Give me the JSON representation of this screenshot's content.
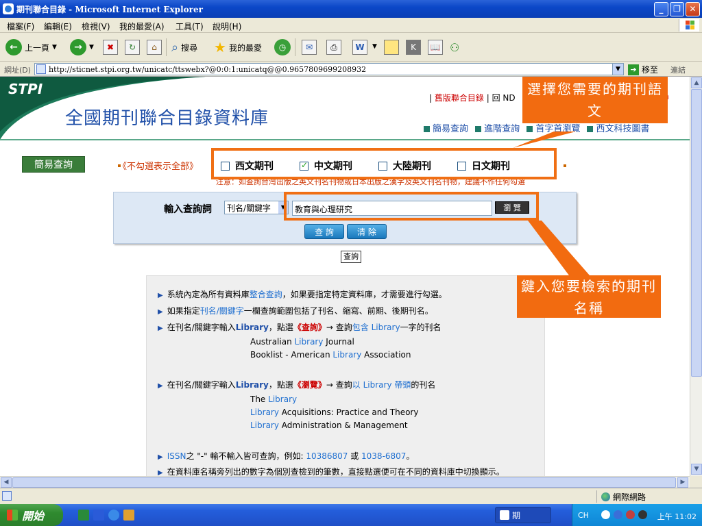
{
  "window": {
    "title": "期刊聯合目錄 - Microsoft Internet Explorer",
    "min": "_",
    "max": "❐",
    "close": "✕"
  },
  "menu": [
    "檔案(F)",
    "編輯(E)",
    "檢視(V)",
    "我的最愛(A)",
    "工具(T)",
    "說明(H)"
  ],
  "toolbar": {
    "back_label": "上一頁",
    "search_label": "搜尋",
    "favorites_label": "我的最愛"
  },
  "address": {
    "label": "網址(D)",
    "url": "http://sticnet.stpi.org.tw/unicatc/ttswebx?@0:0:1:unicatq@@0.9657809699208932",
    "go_label": "移至",
    "links_label": "連結"
  },
  "header": {
    "logo": "STPI",
    "title": "全國期刊聯合目錄資料庫",
    "top_link": "舊版聯合目錄",
    "top_link_2": "回 ND",
    "top_link_3": "sh",
    "nav": [
      "簡易查詢",
      "進階查詢",
      "首字首瀏覽",
      "西文科技圖書"
    ]
  },
  "tabs": {
    "simple": "簡易查詢"
  },
  "languages": {
    "prefix": "《不勾選表示全部》",
    "items": [
      {
        "label": "西文期刊",
        "checked": false
      },
      {
        "label": "中文期刊",
        "checked": true
      },
      {
        "label": "大陸期刊",
        "checked": false
      },
      {
        "label": "日文期刊",
        "checked": false
      }
    ],
    "note": "注意：如查詢台灣出版之英文刊名刊物或日本出版之漢字及英文刊名刊物，建議不作任何勾選"
  },
  "search": {
    "label": "輸入查詢詞",
    "field_select": "刊名/關鍵字",
    "input_value": "教育與心理研究",
    "browse_label": "瀏 覽",
    "query_label": "查 詢",
    "clear_label": "清 除",
    "query_small": "查詢"
  },
  "info": {
    "line1_a": "系統內定為所有資料庫",
    "line1_link": "整合查詢",
    "line1_b": "，如果要指定特定資料庫，才需要進行勾選。",
    "line2_a": "如果指定",
    "line2_link": "刊名/關鍵字",
    "line2_b": "一欄查詢範圍包括了刊名、縮寫、前期、後期刊名。",
    "line3_a": "在刊名/關鍵字輸入",
    "line3_kw": "Library",
    "line3_b": "，點選",
    "line3_act": "《查詢》",
    "line3_c": "→ 查詢",
    "line3_link": "包含 Library",
    "line3_d": "一字的刊名",
    "ex1": [
      {
        "pre": "Australian ",
        "kw": "Library",
        "post": " Journal"
      },
      {
        "pre": "Booklist - American ",
        "kw": "Library",
        "post": " Association"
      }
    ],
    "line4_a": "在刊名/關鍵字輸入",
    "line4_kw": "Library",
    "line4_b": "，點選",
    "line4_act": "《瀏覽》",
    "line4_c": "→ 查詢",
    "line4_link": "以 Library 帶頭",
    "line4_d": "的刊名",
    "ex2": [
      {
        "pre": "The ",
        "kw": "Library",
        "post": ""
      },
      {
        "pre": "",
        "kw": "Library",
        "post": " Acquisitions: Practice and Theory"
      },
      {
        "pre": "",
        "kw": "Library",
        "post": " Administration & Management"
      }
    ],
    "line5_a": "ISSN",
    "line5_b": "之 \"-\" 輸不輸入皆可查詢，例如: ",
    "line5_ex1": "10386807",
    "line5_or": " 或 ",
    "line5_ex2": "1038-6807",
    "line5_end": "。",
    "line6": "在資料庫名稱旁列出的數字為個別查檢到的筆數，直接點選便可在不同的資料庫中切換顯示。"
  },
  "callouts": {
    "top": "選擇您需要的期刊語文",
    "bottom": "鍵入您要檢索的期刊名稱"
  },
  "status": {
    "zone": "網際網路"
  },
  "taskbar": {
    "start": "開始",
    "task": "期",
    "lang": "CH",
    "clock": "上午 11:02"
  },
  "colors": {
    "accent_orange": "#f26b10",
    "title_blue": "#1f4fa8",
    "xp_blue": "#245edb"
  }
}
